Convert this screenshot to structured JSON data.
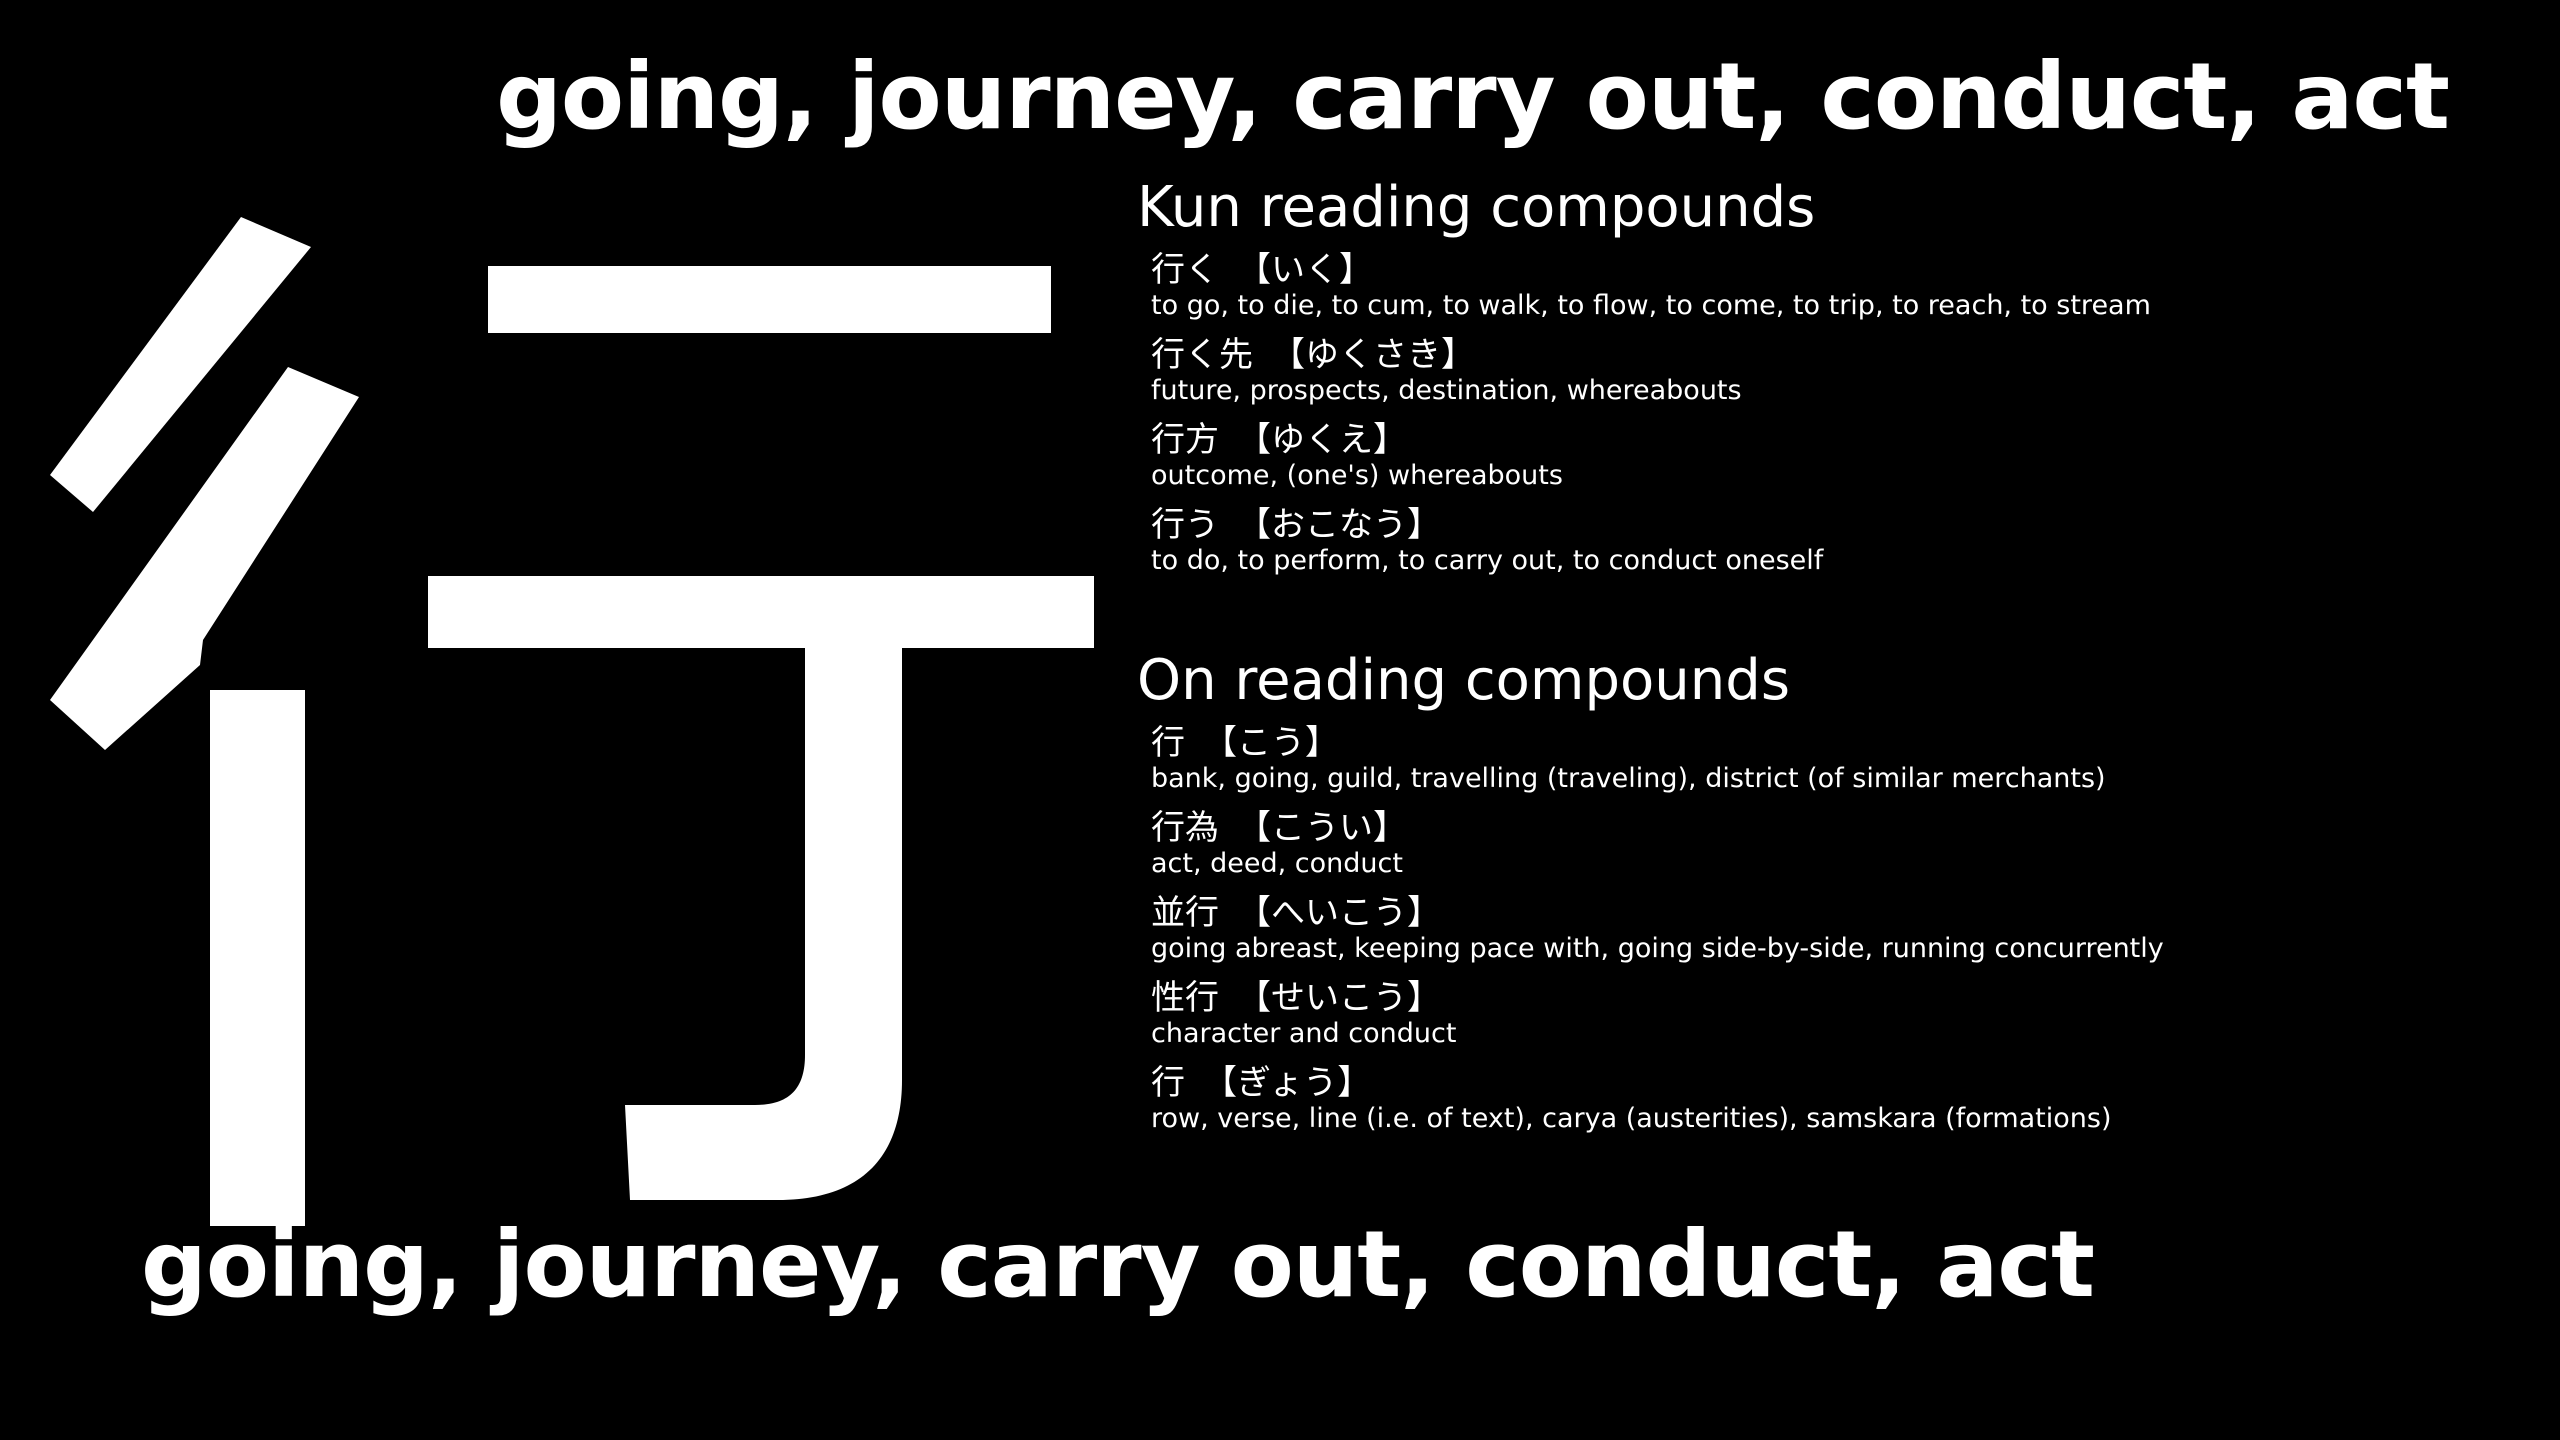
{
  "kanji": "行",
  "meaning": "going, journey, carry out, conduct, act",
  "kun": {
    "title": "Kun reading compounds",
    "entries": [
      {
        "word": "行く",
        "reading": "【いく】",
        "definition": "to go, to die, to cum, to walk, to flow, to come, to trip, to reach, to stream"
      },
      {
        "word": "行く先",
        "reading": "【ゆくさき】",
        "definition": "future, prospects, destination, whereabouts"
      },
      {
        "word": "行方",
        "reading": "【ゆくえ】",
        "definition": "outcome, (one's) whereabouts"
      },
      {
        "word": "行う",
        "reading": "【おこなう】",
        "definition": "to do, to perform, to carry out, to conduct oneself"
      }
    ]
  },
  "on": {
    "title": "On reading compounds",
    "entries": [
      {
        "word": "行",
        "reading": "【こう】",
        "definition": "bank, going, guild, travelling (traveling), district (of similar merchants)"
      },
      {
        "word": "行為",
        "reading": "【こうい】",
        "definition": "act, deed, conduct"
      },
      {
        "word": "並行",
        "reading": "【へいこう】",
        "definition": "going abreast, keeping pace with, going side-by-side, running concurrently"
      },
      {
        "word": "性行",
        "reading": "【せいこう】",
        "definition": "character and conduct"
      },
      {
        "word": "行",
        "reading": "【ぎょう】",
        "definition": "row, verse, line (i.e. of text), carya (austerities), samskara (formations)"
      }
    ]
  },
  "colors": {
    "background": "#000000",
    "text": "#ffffff"
  }
}
